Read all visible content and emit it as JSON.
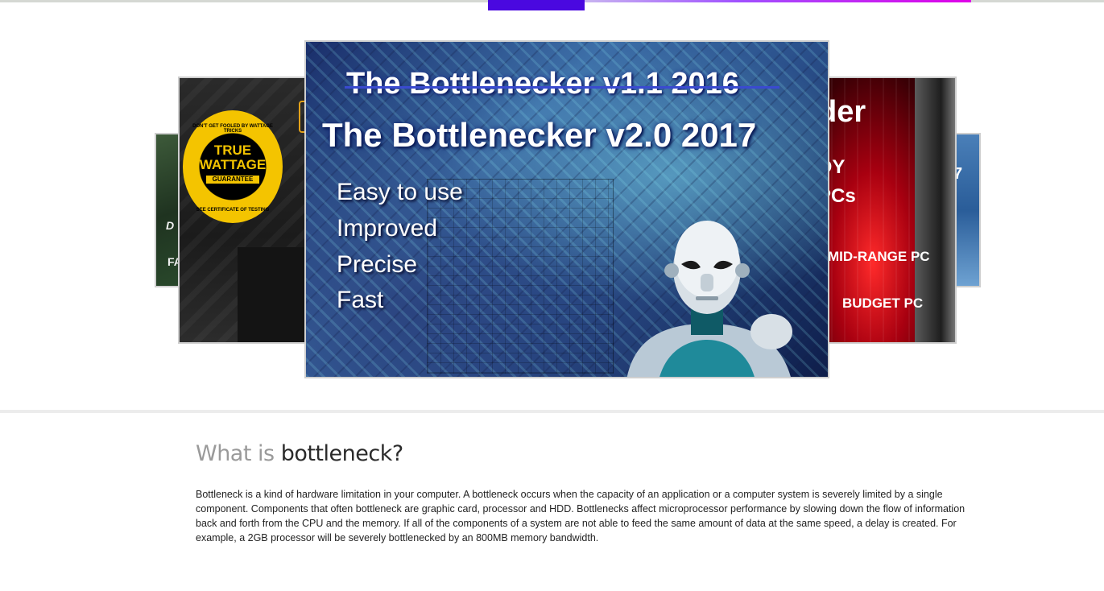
{
  "progress_bar": {
    "active_color": "#4a08e0",
    "gradient_colors": [
      "#c8b4f0",
      "#a050ff",
      "#e000e8"
    ]
  },
  "carousel": {
    "slides": [
      {
        "id": "far-left",
        "visible_text": [
          "D",
          "FA"
        ]
      },
      {
        "id": "left",
        "badge": {
          "top_arc": "DON'T GET FOOLED BY WATTAGE TRICKS",
          "line1": "TRUE",
          "line2": "WATTAGE",
          "ribbon": "GUARANTEE",
          "bottom_arc": "SEE CERTIFICATE OF TESTING"
        }
      },
      {
        "id": "main",
        "title_old": "The Bottlenecker v1.1 2016",
        "title_new": "The Bottlenecker v2.0 2017",
        "features": [
          "Easy to use",
          "Improved",
          "Precise",
          "Fast"
        ]
      },
      {
        "id": "right",
        "title": "der",
        "line2": "DY",
        "line3": "PCs",
        "line4": "MID-RANGE PC",
        "line5": "BUDGET PC"
      },
      {
        "id": "far-right",
        "visible_text": "7"
      }
    ]
  },
  "section": {
    "heading_light": "What is",
    "heading_dark": "bottleneck?",
    "paragraph": "Bottleneck is a kind of hardware limitation in your computer. A bottleneck occurs when the capacity of an application or a computer system is severely limited by a single component. Components that often bottleneck are graphic card, processor and HDD. Bottlenecks affect microprocessor performance by slowing down the flow of information back and forth from the CPU and the memory. If all of the components of a system are not able to feed the same amount of data at the same speed, a delay is created. For example, a 2GB processor will be severely bottlenecked by an 800MB memory bandwidth."
  }
}
